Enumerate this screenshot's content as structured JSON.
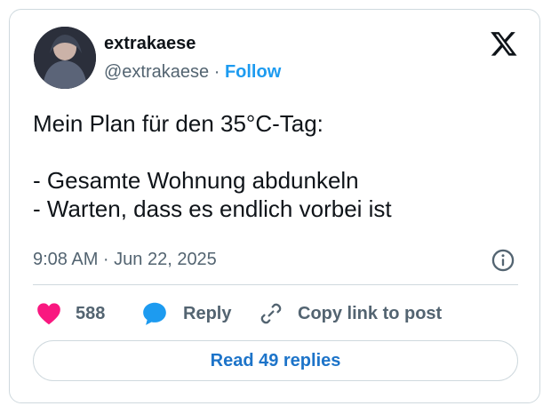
{
  "user": {
    "display_name": "extrakaese",
    "handle": "@extrakaese",
    "separator": "·",
    "follow_label": "Follow"
  },
  "tweet": {
    "text": "Mein Plan für den 35°C-Tag:\n\n- Gesamte Wohnung abdunkeln\n- Warten, dass es endlich vorbei ist",
    "timestamp": "9:08 AM · Jun 22, 2025"
  },
  "actions": {
    "like_count": "588",
    "reply_label": "Reply",
    "copy_label": "Copy link to post"
  },
  "footer": {
    "read_replies_label": "Read 49 replies"
  },
  "colors": {
    "accent": "#1d9bf0",
    "like": "#f91880",
    "text": "#0f1419",
    "muted": "#536471",
    "border": "#cfd9de"
  },
  "icons": [
    "x-logo-icon",
    "info-icon",
    "heart-icon",
    "reply-bubble-icon",
    "link-icon"
  ]
}
